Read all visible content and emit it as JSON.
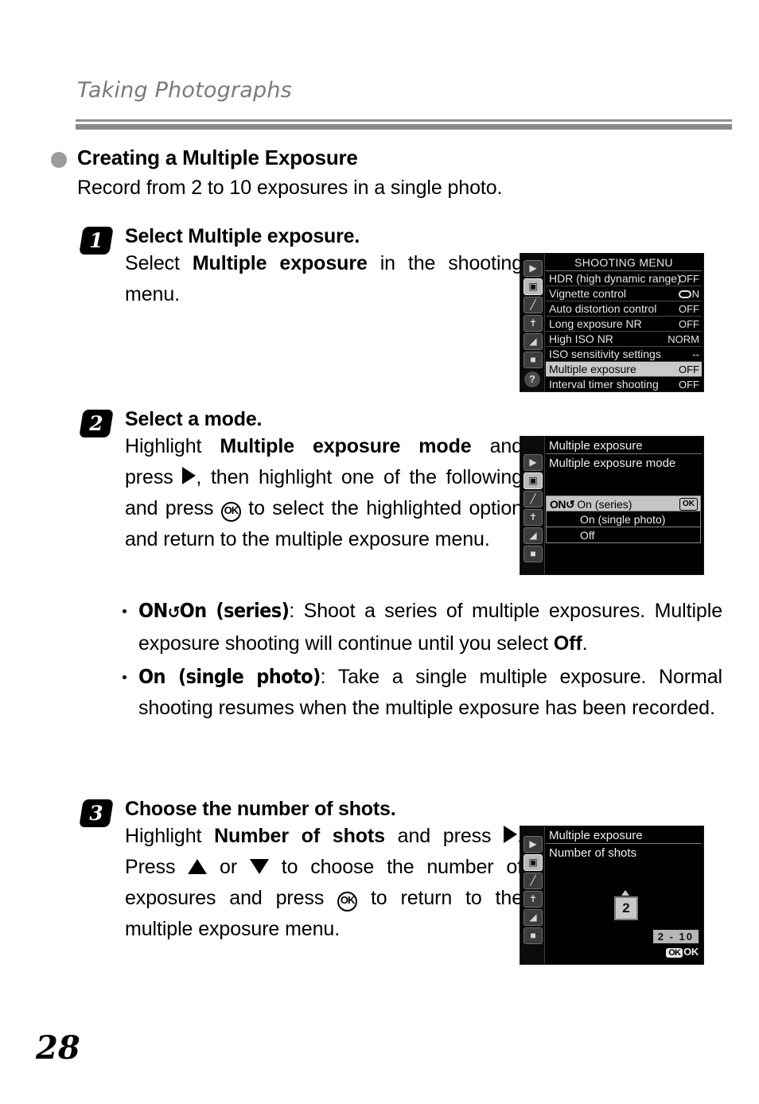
{
  "page": {
    "running_head": "Taking Photographs",
    "folio": "28",
    "section_title": "Creating a Multiple Exposure",
    "section_intro": "Record from 2 to 10 exposures in a single photo."
  },
  "steps": [
    {
      "number": "1",
      "title_prefix": "Select ",
      "title_bold": "Multiple exposure.",
      "body_parts": [
        "Select ",
        "Multiple exposure",
        " in the shooting menu."
      ]
    },
    {
      "number": "2",
      "title": "Select a mode.",
      "body_1": "Highlight ",
      "body_bold_1": "Multiple exposure mode",
      "body_2": " and press ",
      "body_3": ", then highlight one of the following and press ",
      "body_4": " to select the highlighted option and return to the multiple exposure menu."
    },
    {
      "number": "3",
      "title": "Choose the number of shots.",
      "body_1": "Highlight ",
      "body_bold_1": "Number of shots",
      "body_2": " and press ",
      "body_3": ". Press ",
      "body_4": " or ",
      "body_5": " to choose the number of exposures and press ",
      "body_6": " to return to the multiple exposure menu."
    }
  ],
  "bullets": [
    {
      "badge": "ON",
      "cycle": "↺",
      "term": "On (series)",
      "text_1": ": Shoot a series of multiple exposures. Multiple exposure shooting will continue until you select ",
      "term_2": "Off",
      "text_2": "."
    },
    {
      "term": "On (single photo)",
      "text_1": ": Take a single multiple exposure. Normal shooting resumes when the multiple exposure has been recorded."
    }
  ],
  "glyphs": {
    "ok": "OK",
    "right_arrow": "right-arrow",
    "up_arrow": "up-arrow",
    "down_arrow": "down-arrow"
  },
  "lcd_shooting_menu": {
    "title": "SHOOTING MENU",
    "rail_icons": [
      "playback",
      "shooting",
      "custom-setting",
      "setup",
      "retouch",
      "recent-settings"
    ],
    "active_rail_index": 1,
    "help_icon": "?",
    "rows": [
      {
        "label": "HDR (high dynamic range)",
        "value": "OFF",
        "selected": false
      },
      {
        "label": "Vignette control",
        "value": "N",
        "icon": "vignette-frame",
        "selected": false
      },
      {
        "label": "Auto distortion control",
        "value": "OFF",
        "selected": false
      },
      {
        "label": "Long exposure NR",
        "value": "OFF",
        "selected": false
      },
      {
        "label": "High ISO NR",
        "value": "NORM",
        "selected": false
      },
      {
        "label": "ISO sensitivity settings",
        "value": "--",
        "selected": false
      },
      {
        "label": "Multiple exposure",
        "value": "OFF",
        "selected": true
      },
      {
        "label": "Interval timer shooting",
        "value": "OFF",
        "selected": false
      }
    ]
  },
  "lcd_mode_menu": {
    "header": "Multiple exposure",
    "subheader": "Multiple exposure mode",
    "options": [
      {
        "badge": "ON↺",
        "label": "On (series)",
        "selected": true,
        "ok_badge": "OK"
      },
      {
        "badge": "",
        "label": "On (single photo)",
        "selected": false
      },
      {
        "badge": "",
        "label": "Off",
        "selected": false
      }
    ]
  },
  "lcd_shots_menu": {
    "header": "Multiple exposure",
    "subheader": "Number of shots",
    "value": "2",
    "range": "2 - 10",
    "ok_badge": "OK",
    "ok_label": "OK"
  },
  "colors": {
    "rule": "#8a8a8a",
    "bullet": "#9b9b9b",
    "running_head": "#7a7a7a",
    "lcd_background": "#000000",
    "lcd_highlight": "#c9c9c9"
  }
}
